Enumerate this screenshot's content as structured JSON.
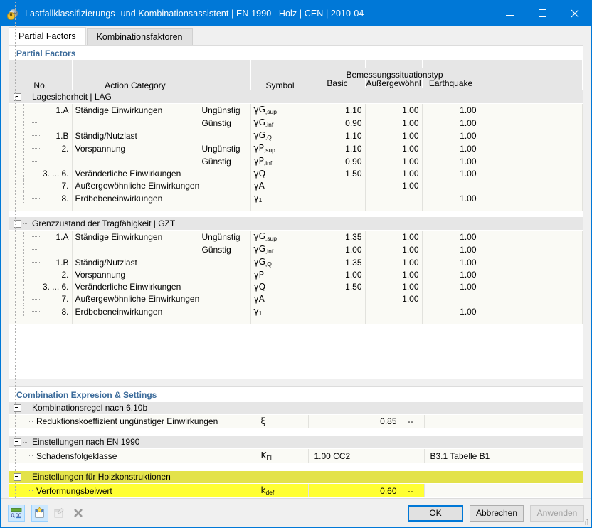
{
  "window": {
    "title": "Lastfallklassifizierungs- und Kombinationsassistent | EN 1990 | Holz | CEN | 2010-04",
    "icon": "load-wizard-icon",
    "minimize_label": "—",
    "maximize_label": "□",
    "close_label": "✕",
    "accent_color": "#0078d7"
  },
  "tabs": [
    {
      "label": "Partial Factors",
      "active": true
    },
    {
      "label": "Kombinationsfaktoren",
      "active": false
    }
  ],
  "partial_factors": {
    "section_title": "Partial Factors",
    "columns": {
      "no": "No.",
      "action_category": "Action Category",
      "favourability": "",
      "symbol": "Symbol",
      "group": "Bemessungssituationstyp",
      "basic": "Basic",
      "accidental": "Außergewöhnl",
      "earthquake": "Earthquake"
    },
    "groups": [
      {
        "label": "Lagesicherheit | LAG",
        "rows": [
          {
            "no": "1.A",
            "category": "Ständige Einwirkungen",
            "fav": "Ungünstig",
            "sym_base": "γG",
            "sym_sub": ",sup",
            "basic": "1.10",
            "accidental": "1.00",
            "earthquake": "1.00"
          },
          {
            "no": "",
            "category": "",
            "fav": "Günstig",
            "sym_base": "γG",
            "sym_sub": ",inf",
            "basic": "0.90",
            "accidental": "1.00",
            "earthquake": "1.00"
          },
          {
            "no": "1.B",
            "category": "Ständig/Nutzlast",
            "fav": "",
            "sym_base": "γG",
            "sym_sub": ",Q",
            "basic": "1.10",
            "accidental": "1.00",
            "earthquake": "1.00"
          },
          {
            "no": "2.",
            "category": "Vorspannung",
            "fav": "Ungünstig",
            "sym_base": "γP",
            "sym_sub": ",sup",
            "basic": "1.10",
            "accidental": "1.00",
            "earthquake": "1.00"
          },
          {
            "no": "",
            "category": "",
            "fav": "Günstig",
            "sym_base": "γP",
            "sym_sub": ",inf",
            "basic": "0.90",
            "accidental": "1.00",
            "earthquake": "1.00"
          },
          {
            "no": "3. ... 6.",
            "category": "Veränderliche Einwirkungen",
            "fav": "",
            "sym_base": "γQ",
            "sym_sub": "",
            "basic": "1.50",
            "accidental": "1.00",
            "earthquake": "1.00"
          },
          {
            "no": "7.",
            "category": "Außergewöhnliche Einwirkungen",
            "fav": "",
            "sym_base": "γA",
            "sym_sub": "",
            "basic": "",
            "accidental": "1.00",
            "earthquake": ""
          },
          {
            "no": "8.",
            "category": "Erdbebeneinwirkungen",
            "fav": "",
            "sym_base": "γ",
            "sym_sub": "1",
            "basic": "",
            "accidental": "",
            "earthquake": "1.00"
          }
        ]
      },
      {
        "label": "Grenzzustand der Tragfähigkeit | GZT",
        "rows": [
          {
            "no": "1.A",
            "category": "Ständige Einwirkungen",
            "fav": "Ungünstig",
            "sym_base": "γG",
            "sym_sub": ",sup",
            "basic": "1.35",
            "accidental": "1.00",
            "earthquake": "1.00"
          },
          {
            "no": "",
            "category": "",
            "fav": "Günstig",
            "sym_base": "γG",
            "sym_sub": ",inf",
            "basic": "1.00",
            "accidental": "1.00",
            "earthquake": "1.00"
          },
          {
            "no": "1.B",
            "category": "Ständig/Nutzlast",
            "fav": "",
            "sym_base": "γG",
            "sym_sub": ",Q",
            "basic": "1.35",
            "accidental": "1.00",
            "earthquake": "1.00"
          },
          {
            "no": "2.",
            "category": "Vorspannung",
            "fav": "",
            "sym_base": "γP",
            "sym_sub": "",
            "basic": "1.00",
            "accidental": "1.00",
            "earthquake": "1.00"
          },
          {
            "no": "3. ... 6.",
            "category": "Veränderliche Einwirkungen",
            "fav": "",
            "sym_base": "γQ",
            "sym_sub": "",
            "basic": "1.50",
            "accidental": "1.00",
            "earthquake": "1.00"
          },
          {
            "no": "7.",
            "category": "Außergewöhnliche Einwirkungen",
            "fav": "",
            "sym_base": "γA",
            "sym_sub": "",
            "basic": "",
            "accidental": "1.00",
            "earthquake": ""
          },
          {
            "no": "8.",
            "category": "Erdbebeneinwirkungen",
            "fav": "",
            "sym_base": "γ",
            "sym_sub": "1",
            "basic": "",
            "accidental": "",
            "earthquake": "1.00"
          }
        ]
      }
    ]
  },
  "settings": {
    "section_title": "Combination Expresion & Settings",
    "groups": [
      {
        "label": "Kombinationsregel nach 6.10b",
        "highlighted": false,
        "rows": [
          {
            "name": "Reduktionskoeffizient ungünstiger Einwirkungen",
            "sym_base": "ξ",
            "sym_sub": "",
            "value": "0.85",
            "unit": "--",
            "reference": "",
            "highlighted": false
          }
        ]
      },
      {
        "label": "Einstellungen nach EN 1990",
        "highlighted": false,
        "rows": [
          {
            "name": "Schadensfolgeklasse",
            "sym_base": "K",
            "sym_sub": "FI",
            "value": "1.00 CC2",
            "unit": "",
            "reference": "B3.1 Tabelle B1",
            "highlighted": false,
            "value_align": "left"
          }
        ]
      },
      {
        "label": "Einstellungen für Holzkonstruktionen",
        "highlighted": true,
        "rows": [
          {
            "name": "Verformungsbeiwert",
            "sym_base": "k",
            "sym_sub": "def",
            "value": "0.60",
            "unit": "--",
            "reference": "",
            "highlighted": true
          }
        ]
      }
    ],
    "highlight_color": "#ffff33"
  },
  "footer": {
    "tools": [
      {
        "name": "set-decimal-places-icon",
        "label": "0,00",
        "selected": true,
        "enabled": true
      },
      {
        "name": "new-item-icon",
        "label": "",
        "selected": true,
        "enabled": true
      },
      {
        "name": "edit-item-icon",
        "label": "",
        "selected": false,
        "enabled": false
      },
      {
        "name": "delete-item-icon",
        "label": "✕",
        "selected": false,
        "enabled": false
      }
    ],
    "buttons": [
      {
        "label": "OK",
        "style": "primary",
        "enabled": true
      },
      {
        "label": "Abbrechen",
        "style": "normal",
        "enabled": true
      },
      {
        "label": "Anwenden",
        "style": "disabled",
        "enabled": false
      }
    ]
  }
}
